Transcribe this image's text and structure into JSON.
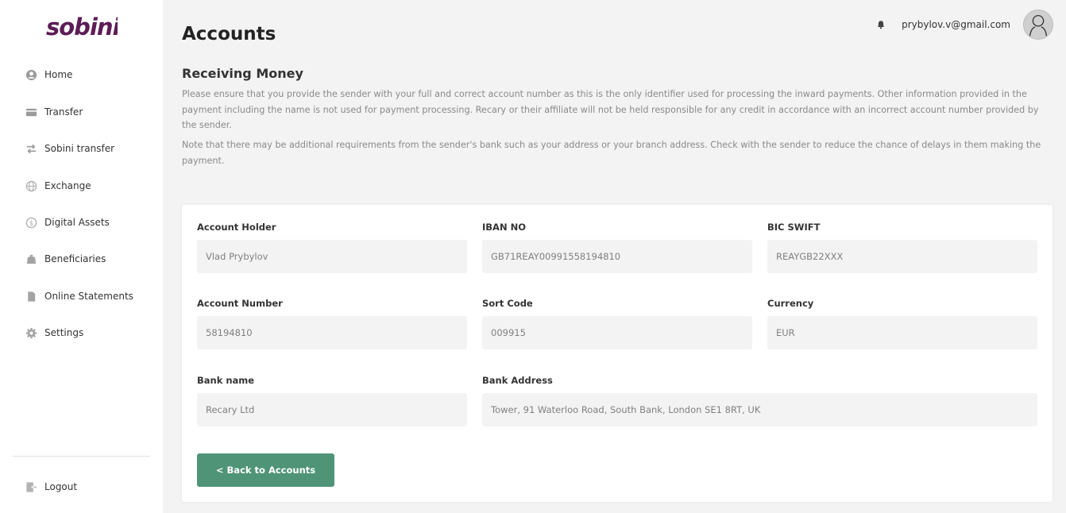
{
  "brand": {
    "logo_text": "sobini",
    "color": "#5c1d57"
  },
  "sidebar": {
    "items": [
      {
        "label": "Home",
        "icon": "user-circle-icon"
      },
      {
        "label": "Transfer",
        "icon": "card-icon"
      },
      {
        "label": "Sobini transfer",
        "icon": "exchange-arrows-icon"
      },
      {
        "label": "Exchange",
        "icon": "globe-icon"
      },
      {
        "label": "Digital Assets",
        "icon": "coin-icon"
      },
      {
        "label": "Beneficiaries",
        "icon": "bag-icon"
      },
      {
        "label": "Online Statements",
        "icon": "document-icon"
      },
      {
        "label": "Settings",
        "icon": "gear-icon"
      }
    ],
    "logout": {
      "label": "Logout",
      "icon": "logout-icon"
    }
  },
  "header": {
    "title": "Accounts",
    "email": "prybylov.v@gmail.com"
  },
  "receiving": {
    "title": "Receiving Money",
    "paragraph1": "Please ensure that you provide the sender with your full and correct account number as this is the only identifier used for processing the inward payments. Other information provided in the payment including the name is not used for payment processing. Recary or their affiliate will not be held responsible for any credit in accordance with an incorrect account number provided by the sender.",
    "paragraph2": "Note that there may be additional requirements from the sender's bank such as your address or your branch address. Check with the sender to reduce the chance of delays in them making the payment."
  },
  "details": {
    "account_holder": {
      "label": "Account Holder",
      "value": "Vlad Prybylov"
    },
    "iban": {
      "label": "IBAN NO",
      "value": "GB71REAY00991558194810"
    },
    "bic": {
      "label": "BIC SWIFT",
      "value": "REAYGB22XXX"
    },
    "account_number": {
      "label": "Account Number",
      "value": "58194810"
    },
    "sort_code": {
      "label": "Sort Code",
      "value": "009915"
    },
    "currency": {
      "label": "Currency",
      "value": "EUR"
    },
    "bank_name": {
      "label": "Bank name",
      "value": "Recary Ltd"
    },
    "bank_address": {
      "label": "Bank Address",
      "value": "Tower, 91 Waterloo Road, South Bank, London SE1 8RT, UK"
    }
  },
  "back_button": {
    "label": "< Back to Accounts",
    "color": "#4f9477"
  },
  "colors": {
    "background": "#f3f3f4",
    "accent": "#4f9477",
    "field_bg": "#f3f3f4"
  }
}
